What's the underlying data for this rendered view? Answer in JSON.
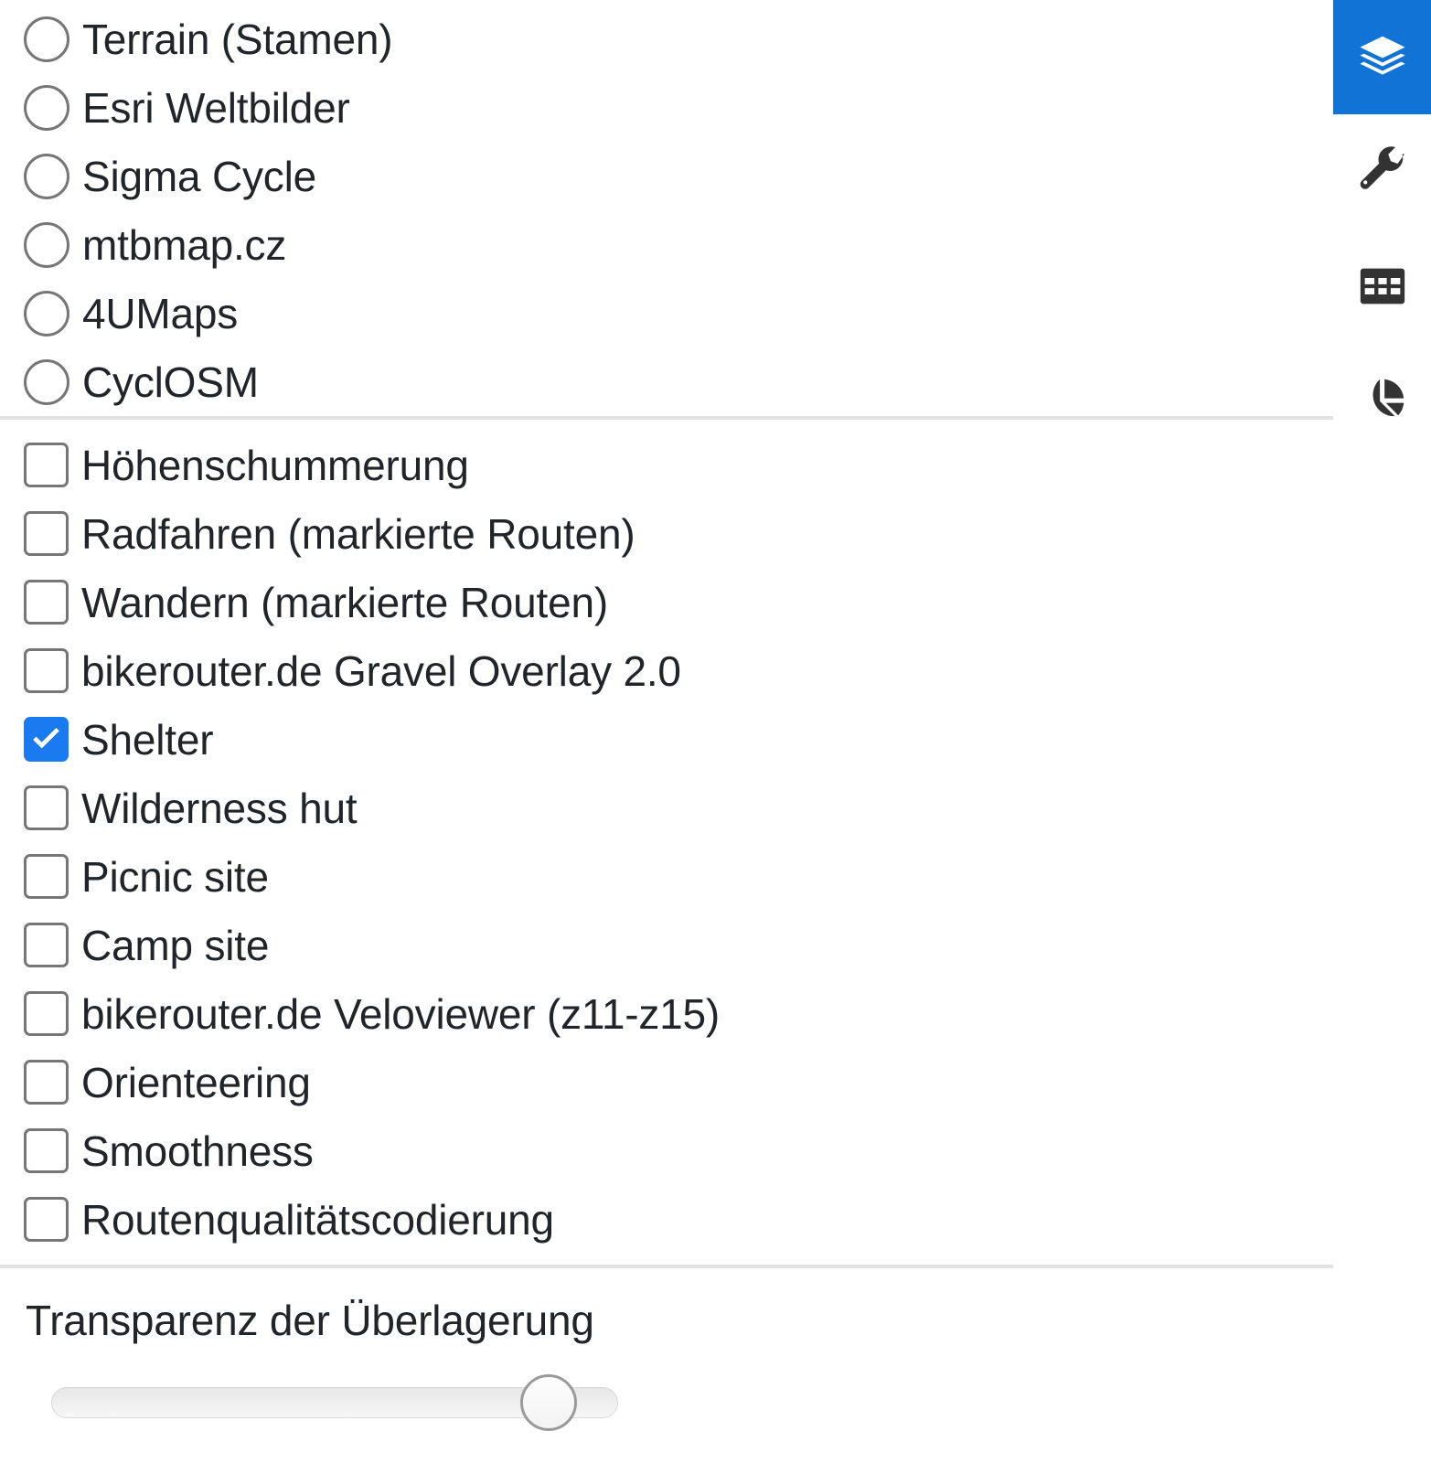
{
  "panel": {
    "base_layers": {
      "type": "radio",
      "items": [
        {
          "label": "Terrain (Stamen)",
          "checked": false
        },
        {
          "label": "Esri Weltbilder",
          "checked": false
        },
        {
          "label": "Sigma Cycle",
          "checked": false
        },
        {
          "label": "mtbmap.cz",
          "checked": false
        },
        {
          "label": "4UMaps",
          "checked": false
        },
        {
          "label": "CyclOSM",
          "checked": false
        }
      ]
    },
    "overlays": {
      "type": "checkbox",
      "items": [
        {
          "label": "Höhenschummerung",
          "checked": false
        },
        {
          "label": "Radfahren (markierte Routen)",
          "checked": false
        },
        {
          "label": "Wandern (markierte Routen)",
          "checked": false
        },
        {
          "label": "bikerouter.de Gravel Overlay 2.0",
          "checked": false
        },
        {
          "label": "Shelter",
          "checked": true
        },
        {
          "label": "Wilderness hut",
          "checked": false
        },
        {
          "label": "Picnic site",
          "checked": false
        },
        {
          "label": "Camp site",
          "checked": false
        },
        {
          "label": "bikerouter.de Veloviewer (z11-z15)",
          "checked": false
        },
        {
          "label": "Orienteering",
          "checked": false
        },
        {
          "label": "Smoothness",
          "checked": false
        },
        {
          "label": "Routenqualitätscodierung",
          "checked": false
        }
      ]
    },
    "transparency": {
      "title": "Transparenz der Überlagerung",
      "value": 92,
      "min": 0,
      "max": 100
    }
  },
  "rail": {
    "buttons": [
      {
        "icon": "layers-icon",
        "active": true
      },
      {
        "icon": "wrench-icon",
        "active": false
      },
      {
        "icon": "table-icon",
        "active": false
      },
      {
        "icon": "pie-chart-icon",
        "active": false
      }
    ]
  },
  "colors": {
    "accent": "#1273d6",
    "checkbox_checked": "#1a7af0",
    "text": "#212529",
    "control_border": "#767676",
    "divider": "#e2e2e2"
  }
}
